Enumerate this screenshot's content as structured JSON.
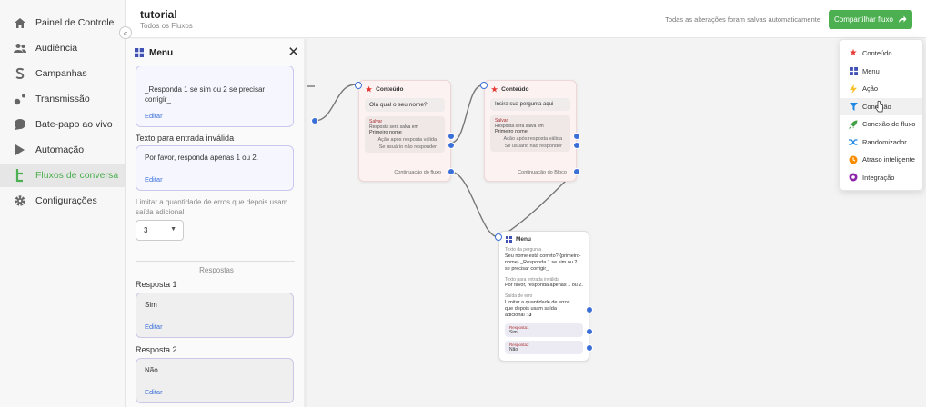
{
  "sidebar": {
    "items": [
      {
        "label": "Painel de Controle",
        "icon": "home-icon"
      },
      {
        "label": "Audiência",
        "icon": "users-icon"
      },
      {
        "label": "Campanhas",
        "icon": "dollar-icon"
      },
      {
        "label": "Transmissão",
        "icon": "broadcast-icon"
      },
      {
        "label": "Bate-papo ao vivo",
        "icon": "chat-icon"
      },
      {
        "label": "Automação",
        "icon": "play-icon"
      },
      {
        "label": "Fluxos de conversa",
        "icon": "flow-icon"
      },
      {
        "label": "Configurações",
        "icon": "gear-icon"
      }
    ],
    "collapse_label": "«"
  },
  "header": {
    "title": "tutorial",
    "subtitle": "Todos os Fluxos",
    "saved_status": "Todas as alterações foram salvas automaticamente",
    "share_label": "Compartilhar fluxo",
    "share_icon": "share-arrow-icon"
  },
  "panel": {
    "title": "Menu",
    "question_text": "_Responda 1 se sim ou 2 se precisar corrigir_",
    "edit_label": "Editar",
    "invalid_label": "Texto para entrada inválida",
    "invalid_text": "Por favor, responda apenas 1 ou 2.",
    "limit_label": "Limitar a quantidade de erros que depois usam saída adicional",
    "limit_value": "3",
    "responses_title": "Respostas",
    "responses": [
      {
        "label": "Resposta 1",
        "value": "Sim"
      },
      {
        "label": "Resposta 2",
        "value": "Não"
      }
    ]
  },
  "nodes": {
    "content1": {
      "title": "Conteúdo",
      "message": "Olá qual o seu nome?",
      "save_tag": "Salvar",
      "save_desc": "Resposta será salva em",
      "save_field": "Primeiro nome",
      "valid_action": "Ação após resposta válida",
      "invalid_action": "Se usuário não responder",
      "continue": "Continuação do fluxo"
    },
    "content2": {
      "title": "Conteúdo",
      "message": "Insira sua pergunta aqui",
      "save_tag": "Salvar",
      "save_desc": "Resposta será salva em",
      "save_field": "Primeiro nome",
      "valid_action": "Ação após resposta válida",
      "invalid_action": "Se usuário não responder",
      "continue": "Continuação do Bloco"
    },
    "menu": {
      "title": "Menu",
      "question_label": "Texto da pergunta",
      "question_text": "Seu nome está correto? {primeiro-nome} _Responda 1 se sim ou 2 se precisar corrigir_",
      "invalid_label": "Texto para entrada inválida",
      "invalid_text": "Por favor, responda apenas 1 ou 2.",
      "error_label": "Saída de erro",
      "error_text": "Limitar a quantidade de erros que depois usam saída adicional :",
      "error_value": "3",
      "responses": [
        {
          "label": "Resposta1",
          "value": "Sim"
        },
        {
          "label": "Resposta2",
          "value": "Não"
        }
      ]
    }
  },
  "dropdown": {
    "items": [
      {
        "label": "Conteúdo",
        "icon": "star-icon",
        "color": "#e53935"
      },
      {
        "label": "Menu",
        "icon": "grid-icon",
        "color": "#3f51b5"
      },
      {
        "label": "Ação",
        "icon": "bolt-icon",
        "color": "#fbc02d"
      },
      {
        "label": "Condição",
        "icon": "filter-icon",
        "color": "#1e88e5"
      },
      {
        "label": "Conexão de fluxo",
        "icon": "rocket-icon",
        "color": "#43a047"
      },
      {
        "label": "Randomizador",
        "icon": "shuffle-icon",
        "color": "#1e88e5"
      },
      {
        "label": "Atraso inteligente",
        "icon": "clock-icon",
        "color": "#fb8c00"
      },
      {
        "label": "Integração",
        "icon": "puzzle-icon",
        "color": "#8e24aa"
      }
    ]
  },
  "colors": {
    "accent": "#4caf50",
    "link": "#3a6fd8",
    "port": "#3a6fd8"
  }
}
